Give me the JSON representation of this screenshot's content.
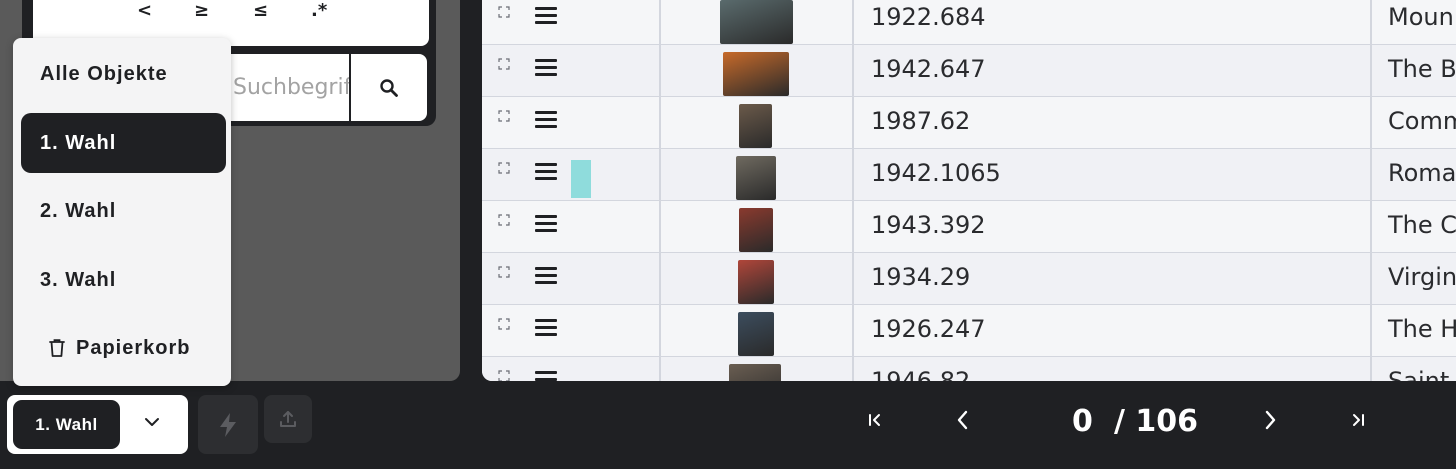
{
  "filter": {
    "operators": [
      "<",
      "≥",
      "≤",
      ".*"
    ],
    "search_placeholder": "Suchbegriff ...",
    "search_icon": "search-icon"
  },
  "menu": {
    "items": [
      {
        "label": "Alle Objekte",
        "active": false
      },
      {
        "label": "1. Wahl",
        "active": true
      },
      {
        "label": "2. Wahl",
        "active": false
      },
      {
        "label": "3. Wahl",
        "active": false
      },
      {
        "label": "Papierkorb",
        "active": false,
        "icon": "trash-icon"
      }
    ]
  },
  "table": {
    "rows": [
      {
        "accession": "1922.684",
        "title": "Moun",
        "thumb_color": "#5a6b6d",
        "highlight": false
      },
      {
        "accession": "1942.647",
        "title": "The B",
        "thumb_color": "#c76a2a",
        "highlight": false
      },
      {
        "accession": "1987.62",
        "title": "Comm",
        "thumb_color": "#6b5a4a",
        "highlight": false
      },
      {
        "accession": "1942.1065",
        "title": "Roma",
        "thumb_color": "#6f6a60",
        "highlight": true
      },
      {
        "accession": "1943.392",
        "title": "The C",
        "thumb_color": "#8a3a2e",
        "highlight": false
      },
      {
        "accession": "1934.29",
        "title": "Virgin",
        "thumb_color": "#b0463a",
        "highlight": false
      },
      {
        "accession": "1926.247",
        "title": "The H",
        "thumb_color": "#3c4d5e",
        "highlight": false
      },
      {
        "accession": "1946.82",
        "title": "Saint",
        "thumb_color": "#6a5e52",
        "highlight": false
      }
    ],
    "highlight_color": "#8fdcdc"
  },
  "bottom": {
    "selection_label": "1. Wahl",
    "page_current": "0",
    "page_total": "/ 106",
    "icons": [
      "lightning-icon",
      "upload-icon",
      "first-page-icon",
      "prev-page-icon",
      "next-page-icon",
      "last-page-icon"
    ]
  },
  "colors": {
    "dark": "#1f2023",
    "panel_gray": "#5a5a5a",
    "table_bg": "#f5f6f8",
    "menu_bg": "#f4f4f5"
  }
}
